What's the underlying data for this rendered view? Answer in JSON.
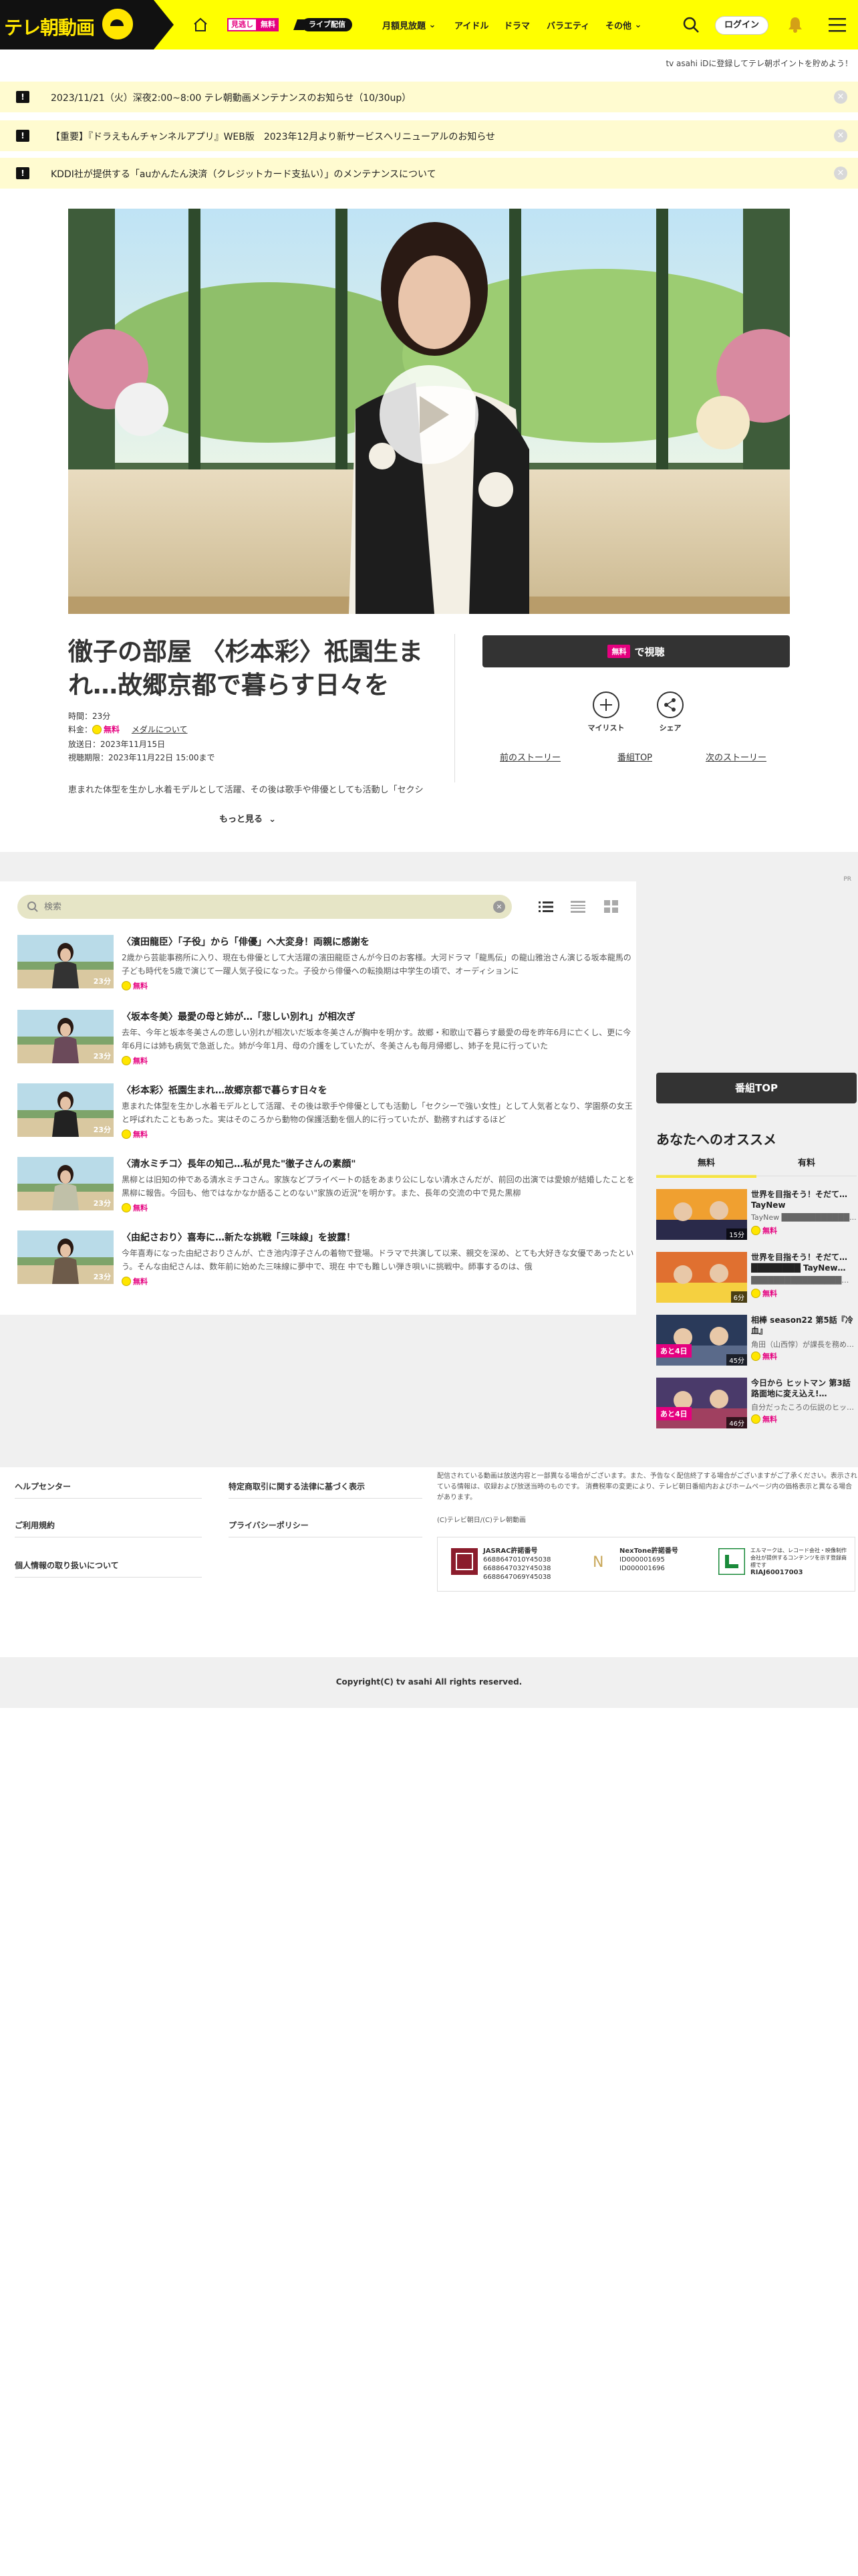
{
  "header": {
    "logo_text": "テレ朝動画",
    "miru_a": "見逃し",
    "miru_b": "無料",
    "live": "ライブ配信",
    "nav": [
      "月額見放題",
      "アイドル",
      "ドラマ",
      "バラエティ",
      "その他"
    ],
    "login": "ログイン"
  },
  "promo_line": "tv asahi iDに登録してテレ朝ポイントを貯めよう！",
  "notices": [
    "2023/11/21（火）深夜2:00~8:00 テレ朝動画メンテナンスのお知らせ（10/30up）",
    "【重要】『ドラえもんチャンネルアプリ』WEB版　2023年12月より新サービスへリニューアルのお知らせ",
    "KDDI社が提供する「auかんたん決済（クレジットカード支払い）」のメンテナンスについて"
  ],
  "episode": {
    "title": "徹子の部屋 〈杉本彩〉祇園生まれ…故郷京都で暮らす日々を",
    "duration_label": "時間：",
    "duration": "23分",
    "fee_label": "料金：",
    "fee": "無料",
    "medal_link": "メダルについて",
    "aired_label": "放送日：",
    "aired": "2023年11月15日",
    "until_label": "視聴期限：",
    "until": "2023年11月22日 15:00まで",
    "description": "恵まれた体型を生かし水着モデルとして活躍、その後は歌手や俳優としても活動し「セクシ",
    "more": "もっと見る"
  },
  "actions": {
    "watch_tag": "無料",
    "watch": "で視聴",
    "mylist": "マイリスト",
    "share": "シェア",
    "prev": "前のストーリー",
    "top": "番組TOP",
    "next": "次のストーリー"
  },
  "ad_label": "PR",
  "episode_search": {
    "placeholder": "検索",
    "clear": "×"
  },
  "episodes": [
    {
      "title": "〈濱田龍臣〉「子役」から「俳優」へ大変身！両親に感謝を",
      "desc": "2歳から芸能事務所に入り、現在も俳優として大活躍の濱田龍臣さんが今日のお客様。大河ドラマ「龍馬伝」の龍山雅治さん演じる坂本龍馬の子ども時代を5歳で演じて一躍人気子役になった。子役から俳優への転換期は中学生の頃で、オーディションに",
      "duration": "23分",
      "fee": "無料"
    },
    {
      "title": "〈坂本冬美〉最愛の母と姉が…「悲しい別れ」が相次ぎ",
      "desc": "去年、今年と坂本冬美さんの悲しい別れが相次いだ坂本冬美さんが胸中を明かす。故郷・和歌山で暮らす最愛の母を昨年6月に亡くし、更に今年6月には姉も病気で急逝した。姉が今年1月、母の介護をしていたが、冬美さんも毎月帰郷し、姉子を見に行っていた",
      "duration": "23分",
      "fee": "無料"
    },
    {
      "title": "〈杉本彩〉祇園生まれ…故郷京都で暮らす日々を",
      "desc": "恵まれた体型を生かし水着モデルとして活躍、その後は歌手や俳優としても活動し「セクシーで強い女性」として人気者となり、学園祭の女王と呼ばれたこともあった。実はそのころから動物の保護活動を個人的に行っていたが、勤務すればするほど",
      "duration": "23分",
      "fee": "無料"
    },
    {
      "title": "〈清水ミチコ〉長年の知己…私が見た\"徹子さんの素顔\"",
      "desc": "黒柳とは旧知の仲である清水ミチコさん。家族などプライベートの話をあまり公にしない清水さんだが、前回の出演では愛娘が結婚したことを黒柳に報告。今回も、他ではなかなか語ることのない\"家族の近況\"を明かす。また、長年の交流の中で見た黒柳",
      "duration": "23分",
      "fee": "無料"
    },
    {
      "title": "〈由紀さおり〉喜寿に…新たな挑戦「三味線」を披露！",
      "desc": "今年喜寿になった由紀さおりさんが、亡き池内淳子さんの着物で登場。ドラマで共演して以来、親交を深め、とても大好きな女優であったという。そんな由紀さんは、数年前に始めた三味線に夢中で、現在 中でも難しい弾き唄いに挑戦中。師事するのは、俄",
      "duration": "23分",
      "fee": "無料"
    }
  ],
  "sidebar": {
    "program_top": "番組TOP",
    "rec_title": "あなたへのオススメ",
    "tabs": [
      "無料",
      "有料"
    ],
    "items": [
      {
        "title": "世界を目指そう！そだて… TayNew ████████████",
        "desc": "TayNew ████████████...",
        "fee": "無料",
        "badge": "",
        "dur": "15分"
      },
      {
        "title": "世界を目指そう！そだて… ████████ TayNew…",
        "desc": "████████████████…",
        "fee": "無料",
        "badge": "",
        "dur": "6分"
      },
      {
        "title": "相棒 season22 第5話『冷血』",
        "desc": "角田（山西惇）が課長を務め…",
        "fee": "無料",
        "badge": "あと4日",
        "dur": "45分"
      },
      {
        "title": "今日から ヒットマン 第3話 路面地に変え込え!…",
        "desc": "自分だったころの伝説のヒッ…",
        "fee": "無料",
        "badge": "あと4日",
        "dur": "46分"
      }
    ]
  },
  "footer": {
    "links_left": [
      "ヘルプセンター",
      "ご利用規約",
      "個人情報の取り扱いについて"
    ],
    "links_mid": [
      "特定商取引に関する法律に基づく表示",
      "プライバシーポリシー"
    ],
    "note": "配信されている動画は放送内容と一部異なる場合がございます。また、予告なく配信終了する場合がございますがご了承ください。表示されている情報は、収録および放送当時のものです。 消費税率の変更により、テレビ朝日番組内およびホームページ内の価格表示と異なる場合があります。",
    "small_copy": "(C)テレビ朝日/(C)テレ朝動画",
    "licenses": [
      {
        "name": "JASRAC許諾番号",
        "nums": [
          "6688647010Y45038",
          "6688647032Y45038",
          "6688647069Y45038"
        ]
      },
      {
        "name": "NexTone許諾番号",
        "nums": [
          "ID000001695",
          "ID000001696"
        ]
      },
      {
        "name": "エルマーク",
        "nums": [
          "エルマークは、レコード会社・映像制作",
          "会社が提供するコンテンツを示す登録商",
          "標です",
          "RIAJ60017003"
        ]
      }
    ],
    "copyright": "Copyright(C) tv asahi All rights reserved."
  },
  "colors": {
    "brand_yellow": "#ffff00",
    "accent_pink": "#e5007f",
    "dark": "#333333"
  }
}
